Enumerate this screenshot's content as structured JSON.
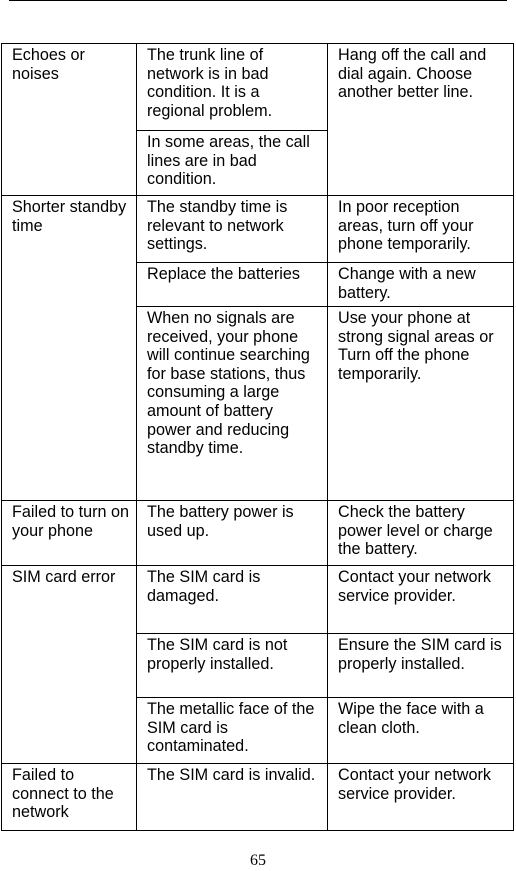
{
  "page": {
    "number": "65"
  },
  "table": {
    "groups": [
      {
        "problem": "Echoes or noises",
        "rows": [
          {
            "cause": "The trunk line of network is in bad condition. It is a regional problem.",
            "solution": "Hang off the call and dial again. Choose another better line."
          },
          {
            "cause": "In some areas, the call lines are in bad condition."
          }
        ]
      },
      {
        "problem": "Shorter standby time",
        "rows": [
          {
            "cause": "The standby time is relevant to network settings.",
            "solution": "In poor reception areas, turn off your phone temporarily."
          },
          {
            "cause": "Replace the batteries",
            "solution": "Change with a new battery."
          },
          {
            "cause": "When no signals are received, your phone will continue searching for base stations, thus consuming a large amount of battery power and reducing standby time.",
            "solution": "Use your phone at strong signal areas or Turn off the phone temporarily."
          }
        ]
      },
      {
        "problem": "Failed to turn on your phone",
        "rows": [
          {
            "cause": "The battery power is used up.",
            "solution": "Check the battery power level or charge the battery."
          }
        ]
      },
      {
        "problem": "SIM card error",
        "rows": [
          {
            "cause": "The SIM card is damaged.",
            "solution": "Contact your network service provider."
          },
          {
            "cause": "The SIM card is not properly installed.",
            "solution": "Ensure the SIM card is properly installed."
          },
          {
            "cause": "The metallic face of the SIM card is contaminated.",
            "solution": "Wipe the face with a clean cloth."
          }
        ]
      },
      {
        "problem": "Failed to connect to the network",
        "rows": [
          {
            "cause": "The SIM card is invalid.",
            "solution": "Contact your network service provider."
          }
        ]
      }
    ]
  }
}
